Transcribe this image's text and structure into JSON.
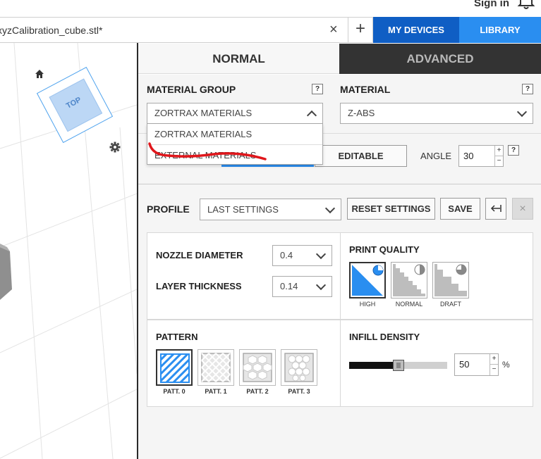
{
  "header": {
    "signin_label": "Sign in"
  },
  "tabs": {
    "file_name": "xyzCalibration_cube.stl*",
    "close_glyph": "×",
    "add_glyph": "+",
    "my_devices": "MY DEVICES",
    "library": "LIBRARY"
  },
  "viewport": {
    "view_cube_label": "TOP"
  },
  "modes": {
    "normal": "NORMAL",
    "advanced": "ADVANCED"
  },
  "material": {
    "group_label": "MATERIAL GROUP",
    "group_value": "ZORTRAX MATERIALS",
    "group_options": [
      "ZORTRAX MATERIALS",
      "EXTERNAL MATERIALS"
    ],
    "material_label": "MATERIAL",
    "material_value": "Z-ABS",
    "help_glyph": "?"
  },
  "support": {
    "editable_label": "EDITABLE",
    "angle_label": "ANGLE",
    "angle_value": "30"
  },
  "profile": {
    "label": "PROFILE",
    "value": "LAST SETTINGS",
    "reset_label": "RESET SETTINGS",
    "save_label": "SAVE",
    "close_glyph": "×"
  },
  "nozzle": {
    "diameter_label": "NOZZLE DIAMETER",
    "diameter_value": "0.4",
    "layer_label": "LAYER THICKNESS",
    "layer_value": "0.14"
  },
  "quality": {
    "title": "PRINT QUALITY",
    "options": [
      "HIGH",
      "NORMAL",
      "DRAFT"
    ],
    "selected": "HIGH"
  },
  "pattern": {
    "title": "PATTERN",
    "options": [
      "PATT. 0",
      "PATT. 1",
      "PATT. 2",
      "PATT. 3"
    ],
    "selected": "PATT. 0"
  },
  "infill": {
    "title": "INFILL DENSITY",
    "value": "50",
    "unit": "%",
    "level": 0.5
  },
  "spin_glyphs": {
    "up": "+",
    "down": "−"
  },
  "colors": {
    "accent_blue": "#2a8ef0",
    "dark_blue": "#0f5ec4",
    "selected_blue": "#2a8ef0",
    "annotation_red": "#e0161b"
  }
}
